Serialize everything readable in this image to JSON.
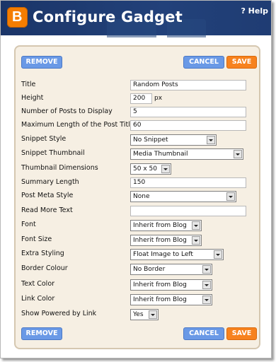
{
  "header": {
    "title": "Configure Gadget",
    "help_label": "? Help"
  },
  "buttons": {
    "remove": "REMOVE",
    "cancel": "CANCEL",
    "save": "SAVE"
  },
  "fields": {
    "title": {
      "label": "Title",
      "value": "Random Posts"
    },
    "height": {
      "label": "Height",
      "value": "200",
      "unit": "px"
    },
    "num_posts": {
      "label": "Number of Posts to Display",
      "value": "5"
    },
    "max_title_len": {
      "label": "Maximum Length of the Post Title",
      "value": "60"
    },
    "snippet_style": {
      "label": "Snippet Style",
      "value": "No Snippet"
    },
    "snippet_thumbnail": {
      "label": "Snippet Thumbnail",
      "value": "Media Thumbnail"
    },
    "thumbnail_dimensions": {
      "label": "Thumbnail Dimensions",
      "value": "50 x 50"
    },
    "summary_length": {
      "label": "Summary Length",
      "value": "150"
    },
    "post_meta_style": {
      "label": "Post Meta Style",
      "value": "None"
    },
    "read_more_text": {
      "label": "Read More Text",
      "value": ""
    },
    "font": {
      "label": "Font",
      "value": "Inherit from Blog"
    },
    "font_size": {
      "label": "Font Size",
      "value": "Inherit from Blog"
    },
    "extra_styling": {
      "label": "Extra Styling",
      "value": "Float Image to Left"
    },
    "border_colour": {
      "label": "Border Colour",
      "value": "No Border"
    },
    "text_color": {
      "label": "Text Color",
      "value": "Inherit from Blog"
    },
    "link_color": {
      "label": "Link Color",
      "value": "Inherit from Blog"
    },
    "show_powered_by": {
      "label": "Show Powered by Link",
      "value": "Yes"
    }
  },
  "colors": {
    "header_bg": "#1e3a6e",
    "panel_bg": "#f6efe3",
    "button_blue": "#6a99e6",
    "button_orange": "#f7821e",
    "logo_orange": "#f57d00"
  },
  "icons": {
    "logo": "blogger-logo-icon",
    "dropdown": "chevron-down-icon"
  }
}
